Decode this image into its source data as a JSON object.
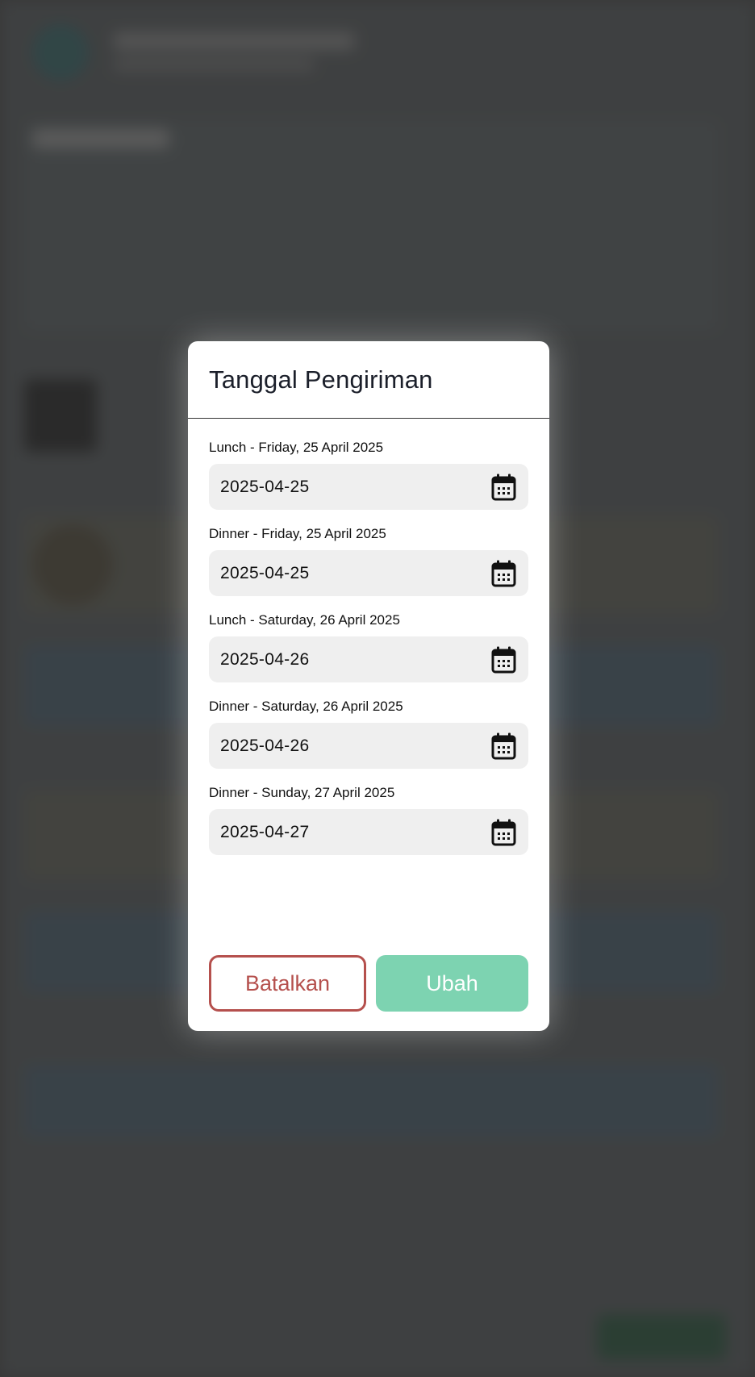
{
  "modal": {
    "title": "Tanggal Pengiriman",
    "fields": [
      {
        "label": "Lunch - Friday, 25 April 2025",
        "value": "2025-04-25",
        "icon": "calendar-icon"
      },
      {
        "label": "Dinner - Friday, 25 April 2025",
        "value": "2025-04-25",
        "icon": "calendar-icon"
      },
      {
        "label": "Lunch - Saturday, 26 April 2025",
        "value": "2025-04-26",
        "icon": "calendar-icon"
      },
      {
        "label": "Dinner - Saturday, 26 April 2025",
        "value": "2025-04-26",
        "icon": "calendar-icon"
      },
      {
        "label": "Dinner - Sunday, 27 April 2025",
        "value": "2025-04-27",
        "icon": "calendar-icon"
      }
    ],
    "cancel_label": "Batalkan",
    "submit_label": "Ubah"
  },
  "colors": {
    "cancel": "#b5504d",
    "submit": "#7dd3b1",
    "field_bg": "#efefef"
  }
}
